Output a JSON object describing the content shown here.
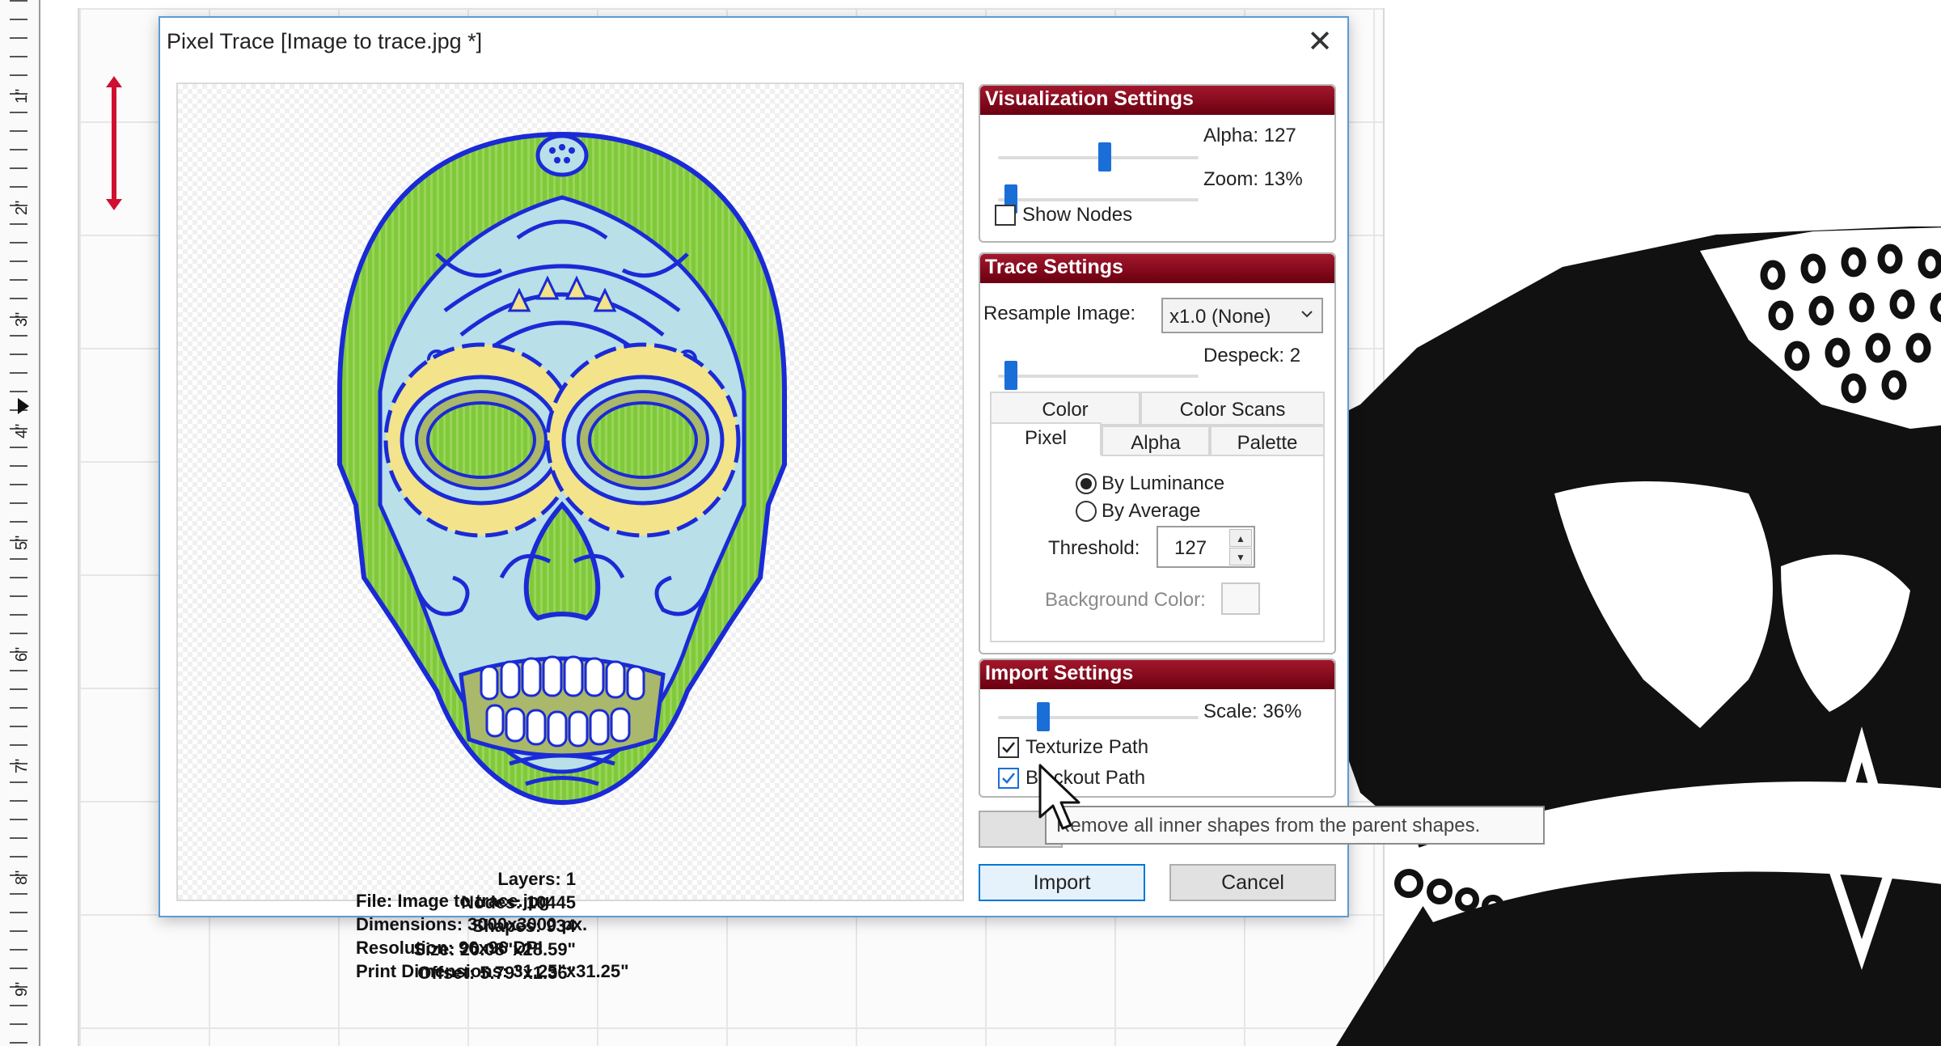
{
  "ruler": {
    "labels": [
      "1\"",
      "2\"",
      "3\"",
      "4\"",
      "5\"",
      "6\"",
      "7\"",
      "8\"",
      "9\""
    ]
  },
  "dialog": {
    "title": "Pixel Trace [Image to trace.jpg *]",
    "close_label": "✕"
  },
  "preview": {
    "info_left": {
      "file": "File: Image to trace.jpg",
      "dimensions": "Dimensions: 3000x3000 px.",
      "resolution": "Resolution: 96x96 DPI",
      "print_dimensions": "Print Dimensions: 31.25\"x31.25\""
    },
    "info_right": {
      "layers": "Layers: 1",
      "nodes": "Nodes: 10445",
      "shapes": "Shapes: 934",
      "size": "Size: 20.08\"x28.59\"",
      "offset": "Offset: 5.79\"x1.36\""
    }
  },
  "visualization": {
    "header": "Visualization Settings",
    "alpha_label": "Alpha: 127",
    "alpha_value": 127,
    "zoom_label": "Zoom: 13%",
    "zoom_value": 13,
    "show_nodes_label": "Show Nodes",
    "show_nodes_checked": false
  },
  "trace": {
    "header": "Trace Settings",
    "resample_label": "Resample Image:",
    "resample_value": "x1.0 (None)",
    "despeck_label": "Despeck: 2",
    "despeck_value": 2,
    "tabs_row1": [
      "Color",
      "Color Scans"
    ],
    "tabs_row2": [
      "Pixel",
      "Alpha",
      "Palette"
    ],
    "active_tab": "Pixel",
    "by_luminance_label": "By Luminance",
    "by_average_label": "By Average",
    "selected_mode": "By Luminance",
    "threshold_label": "Threshold:",
    "threshold_value": "127",
    "background_color_label": "Background Color:"
  },
  "import_settings": {
    "header": "Import Settings",
    "scale_label": "Scale: 36%",
    "scale_value": 36,
    "texturize_label": "Texturize Path",
    "texturize_checked": true,
    "blackout_label": "Blackout Path",
    "blackout_checked": true
  },
  "buttons": {
    "import_label": "Import",
    "cancel_label": "Cancel"
  },
  "tooltip": {
    "text": "Remove all inner shapes from the parent shapes."
  },
  "colors": {
    "header_red": "#8b0a1e",
    "slider_blue": "#1a6ed8",
    "skull_green": "#7fca3a",
    "skull_blue": "#1a2ad6",
    "skull_lightblue": "#b9dfe8",
    "skull_yellow": "#f3e38a"
  }
}
